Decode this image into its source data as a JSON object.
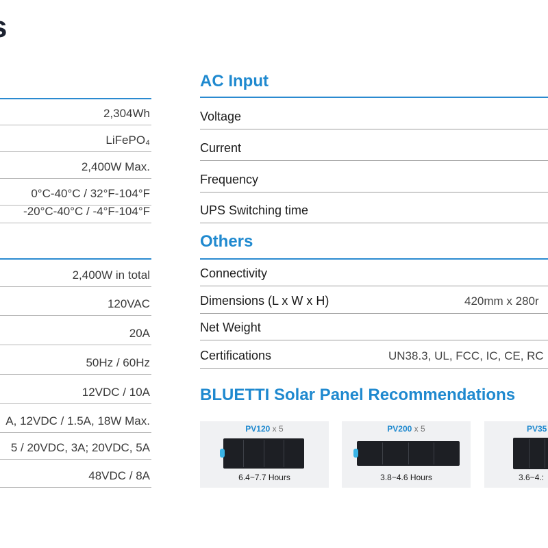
{
  "page": {
    "title_fragment": "s"
  },
  "left": {
    "section1": [
      "2,304Wh",
      "LiFePO₄",
      "2,400W Max.",
      "0°C-40°C / 32°F-104°F",
      "-20°C-40°C / -4°F-104°F"
    ],
    "section2": [
      "2,400W in total",
      "120VAC",
      "20A",
      "50Hz / 60Hz",
      "12VDC / 10A",
      "A, 12VDC / 1.5A, 18W Max.",
      "5 / 20VDC, 3A; 20VDC, 5A",
      "48VDC / 8A"
    ]
  },
  "ac_input": {
    "title": "AC Input",
    "rows": [
      {
        "label": "Voltage",
        "value": ""
      },
      {
        "label": "Current",
        "value": ""
      },
      {
        "label": "Frequency",
        "value": ""
      },
      {
        "label": "UPS Switching time",
        "value": ""
      }
    ]
  },
  "others": {
    "title": "Others",
    "rows": [
      {
        "label": "Connectivity",
        "value": ""
      },
      {
        "label": "Dimensions (L x W x H)",
        "value": "420mm x 280r"
      },
      {
        "label": "Net Weight",
        "value": ""
      },
      {
        "label": "Certifications",
        "value": "UN38.3, UL, FCC, IC, CE, RC"
      }
    ]
  },
  "solar": {
    "title": "BLUETTI Solar Panel Recommendations",
    "cards": [
      {
        "model": "PV120",
        "qty": "x 5",
        "hours": "6.4~7.7 Hours"
      },
      {
        "model": "PV200",
        "qty": "x 5",
        "hours": "3.8~4.6 Hours"
      },
      {
        "model": "PV35",
        "qty": "",
        "hours": "3.6~4.:"
      }
    ]
  },
  "colors": {
    "accent": "#1f89cf",
    "rule": "#2a8ad0",
    "card_bg": "#f0f1f3",
    "panel": "#1d1f24"
  }
}
